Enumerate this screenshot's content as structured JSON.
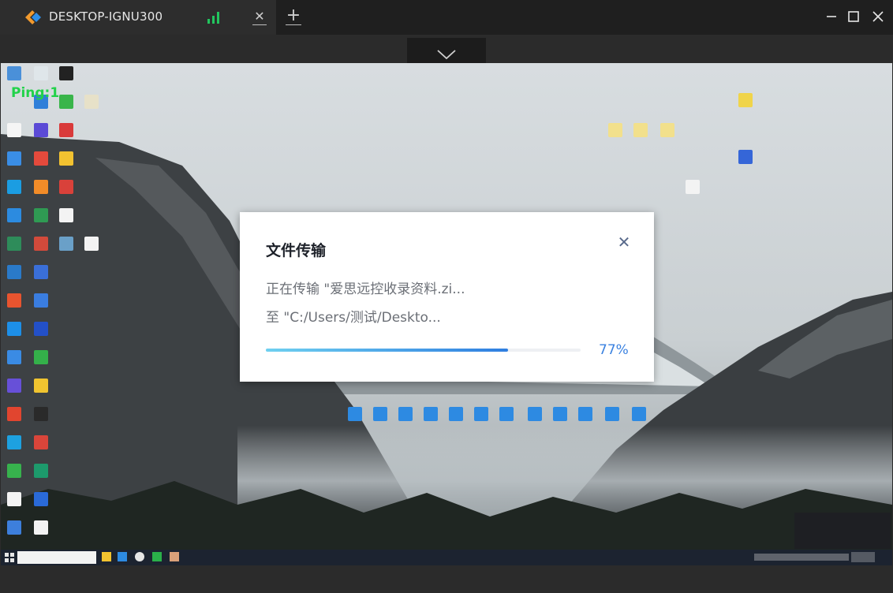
{
  "window": {
    "tab_title": "DESKTOP-IGNU300",
    "tab_close_glyph": "✕",
    "tab_add_glyph": "+",
    "signal_color": "#22c55e"
  },
  "remote": {
    "ping_label": "Ping:1"
  },
  "dialog": {
    "title": "文件传输",
    "close_glyph": "✕",
    "line_transferring": "正在传输 \"爱思远控收录资料.zi...",
    "line_destination": "至 \"C:/Users/测试/Deskto...",
    "progress_fraction": 0.77,
    "progress_label": "77%"
  }
}
